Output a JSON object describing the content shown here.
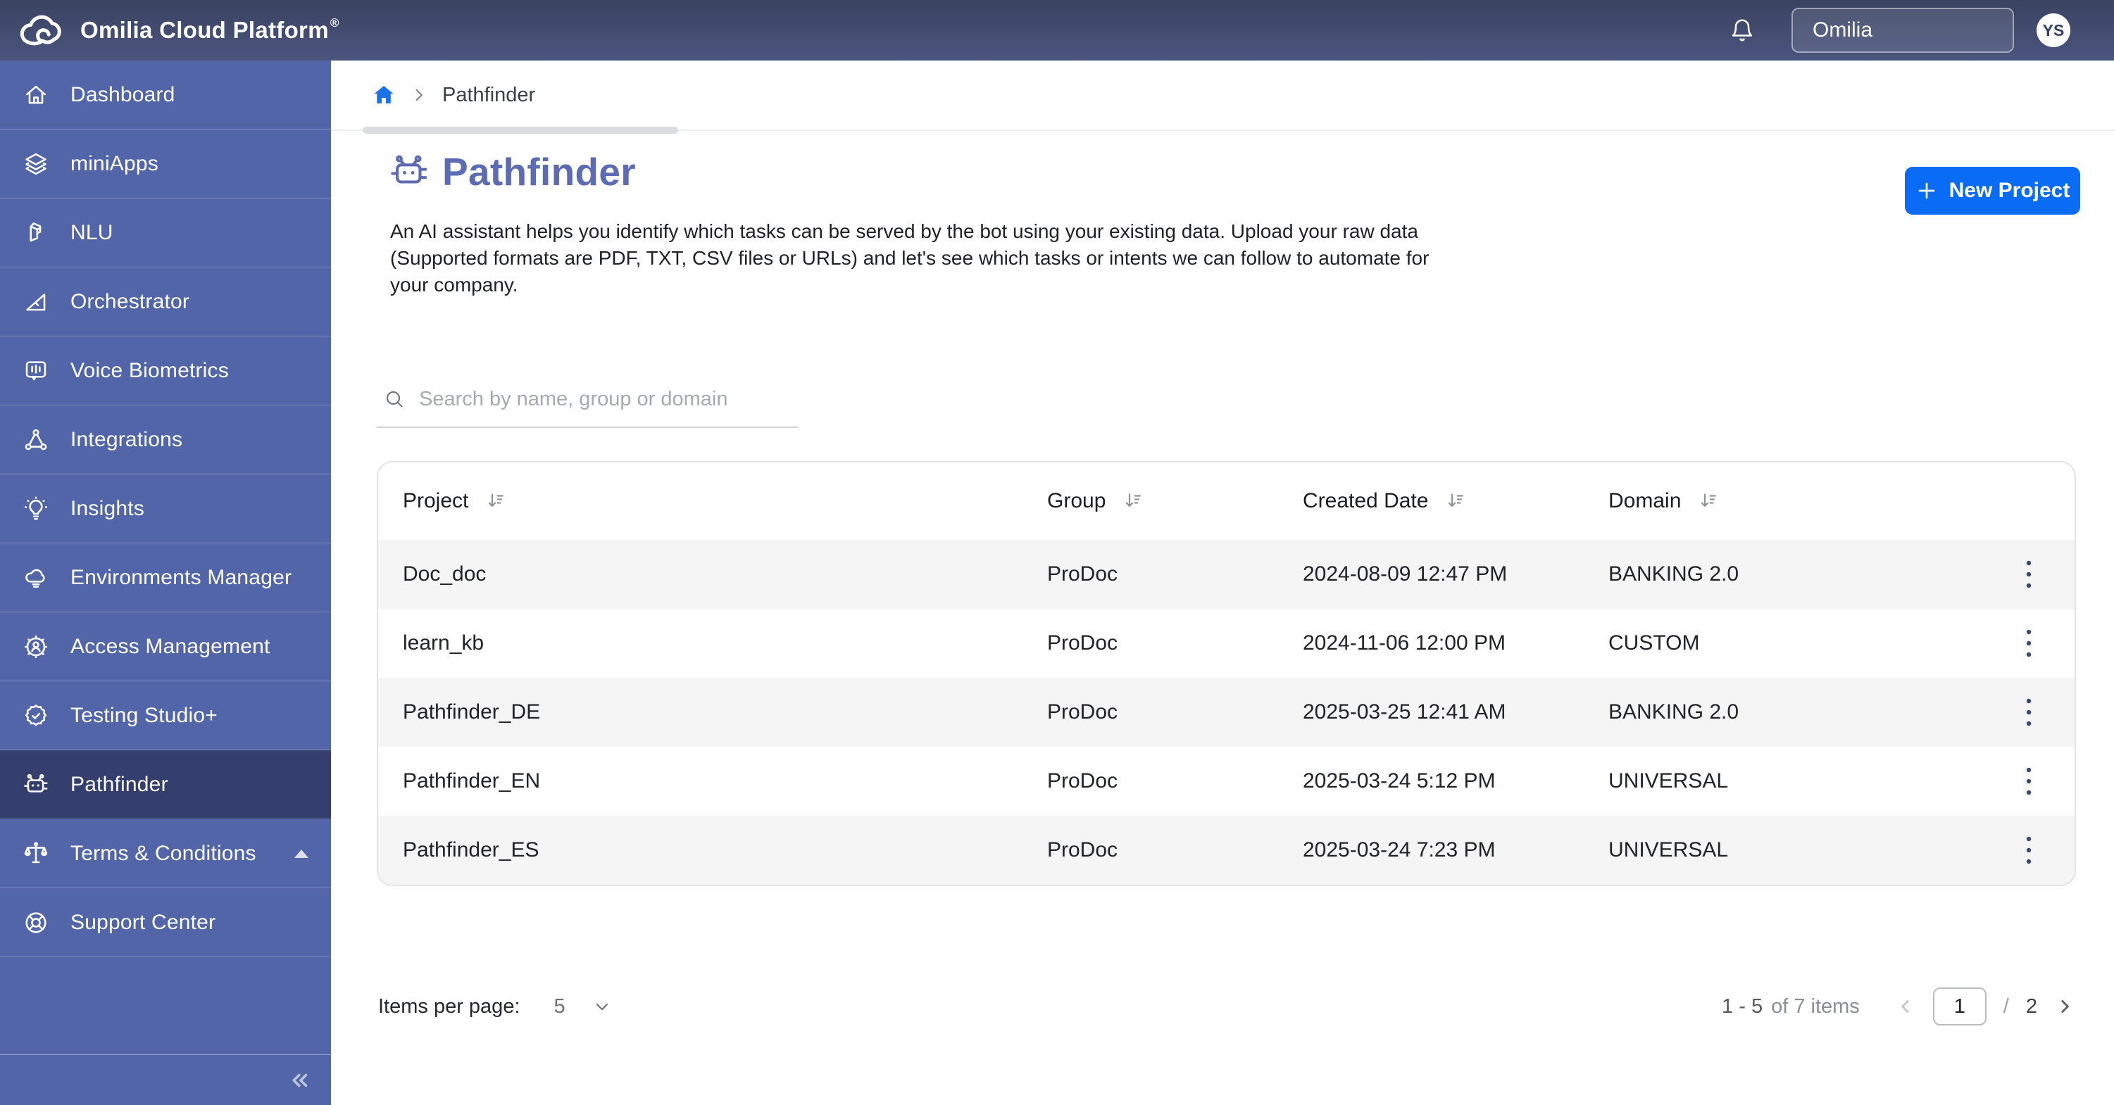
{
  "topbar": {
    "brand": "Omilia Cloud Platform",
    "brand_mark": "®",
    "tenant": "Omilia",
    "avatar_initials": "YS",
    "icons": [
      "cloud-logo",
      "bell",
      "avatar"
    ]
  },
  "sidebar": {
    "items": [
      {
        "label": "Dashboard",
        "icon": "home-icon",
        "active": false
      },
      {
        "label": "miniApps",
        "icon": "layers-icon",
        "active": false
      },
      {
        "label": "NLU",
        "icon": "cube-icon",
        "active": false
      },
      {
        "label": "Orchestrator",
        "icon": "triangle-ruler-icon",
        "active": false
      },
      {
        "label": "Voice Biometrics",
        "icon": "voice-meter-icon",
        "active": false
      },
      {
        "label": "Integrations",
        "icon": "nodes-icon",
        "active": false
      },
      {
        "label": "Insights",
        "icon": "lightbulb-icon",
        "active": false
      },
      {
        "label": "Environments Manager",
        "icon": "cloud-icon",
        "active": false
      },
      {
        "label": "Access Management",
        "icon": "gear-user-icon",
        "active": false
      },
      {
        "label": "Testing Studio+",
        "icon": "badge-check-icon",
        "active": false
      },
      {
        "label": "Pathfinder",
        "icon": "robot-icon",
        "active": true
      },
      {
        "label": "Terms & Conditions",
        "icon": "scales-icon",
        "active": false,
        "expander": "caret-up"
      },
      {
        "label": "Support Center",
        "icon": "lifebuoy-icon",
        "active": false
      }
    ],
    "collapse_icon": "double-chevron-left"
  },
  "breadcrumb": {
    "home_icon": "home-icon",
    "current": "Pathfinder"
  },
  "page": {
    "title": "Pathfinder",
    "title_icon": "robot-icon",
    "description_lines": [
      "An AI assistant helps you identify which tasks can be served by the bot using your existing data. Upload your raw data",
      "(Supported formats are PDF, TXT, CSV files or URLs) and let's see which tasks or intents we can follow to automate for",
      "your company."
    ],
    "new_project_label": "New Project"
  },
  "search": {
    "placeholder": "Search by name, group or domain",
    "value": ""
  },
  "table": {
    "columns": [
      "Project",
      "Group",
      "Created Date",
      "Domain"
    ],
    "sort_icon": "sort-descending-icon",
    "row_action_icon": "kebab-menu-icon",
    "rows": [
      {
        "project": "Doc_doc",
        "group": "ProDoc",
        "created": "2024-08-09 12:47 PM",
        "domain": "BANKING 2.0"
      },
      {
        "project": "learn_kb",
        "group": "ProDoc",
        "created": "2024-11-06 12:00 PM",
        "domain": "CUSTOM"
      },
      {
        "project": "Pathfinder_DE",
        "group": "ProDoc",
        "created": "2025-03-25 12:41 AM",
        "domain": "BANKING 2.0"
      },
      {
        "project": "Pathfinder_EN",
        "group": "ProDoc",
        "created": "2025-03-24 5:12 PM",
        "domain": "UNIVERSAL"
      },
      {
        "project": "Pathfinder_ES",
        "group": "ProDoc",
        "created": "2025-03-24 7:23 PM",
        "domain": "UNIVERSAL"
      }
    ]
  },
  "pagination": {
    "items_per_page_label": "Items per page:",
    "items_per_page_value": "5",
    "range": "1 - 5",
    "of_items": "of 7 items",
    "current_page": "1",
    "separator": "/",
    "total_pages": "2"
  },
  "colors": {
    "topbar_top": "#3a4361",
    "topbar_bottom": "#4b557e",
    "sidebar": "#5165a8",
    "sidebar_active": "#343f6e",
    "accent_blue": "#0a6cf5",
    "title_indigo": "#5c6bb2",
    "breadcrumb_home_blue": "#1a73e8",
    "row_alt_gray": "#f5f5f6"
  }
}
